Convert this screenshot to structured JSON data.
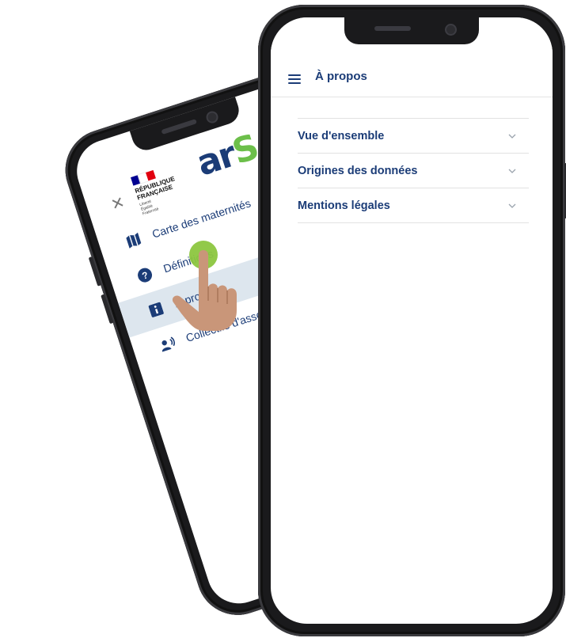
{
  "back_phone": {
    "close_icon": "close-icon",
    "gov_logo": {
      "flag_colors": [
        "#000091",
        "#ffffff",
        "#e1000f"
      ],
      "name": "RÉPUBLIQUE\nFRANÇAISE",
      "motto": "Liberté\nÉgalité\nFraternité"
    },
    "ars_logo": {
      "word_a": "ar",
      "word_s": "S"
    },
    "menu": [
      {
        "label": "Carte des maternités",
        "icon": "map-icon"
      },
      {
        "label": "Définitions",
        "icon": "question-icon"
      },
      {
        "label": "À propos",
        "icon": "info-icon",
        "active": true
      },
      {
        "label": "Collectifs d'associations",
        "icon": "people-icon"
      }
    ]
  },
  "front_phone": {
    "appbar": {
      "title": "À propos",
      "menu_icon": "hamburger-icon"
    },
    "sections": [
      {
        "label": "Vue d'ensemble",
        "icon": "chevron-down-icon"
      },
      {
        "label": "Origines des données",
        "icon": "chevron-down-icon"
      },
      {
        "label": "Mentions légales",
        "icon": "chevron-down-icon"
      }
    ]
  },
  "colors": {
    "brand_blue": "#1b3c77",
    "ars_green": "#6cbf4a",
    "tap_green": "#8cc63f",
    "active_bg": "#dde6ee",
    "skin": "#c99679"
  }
}
